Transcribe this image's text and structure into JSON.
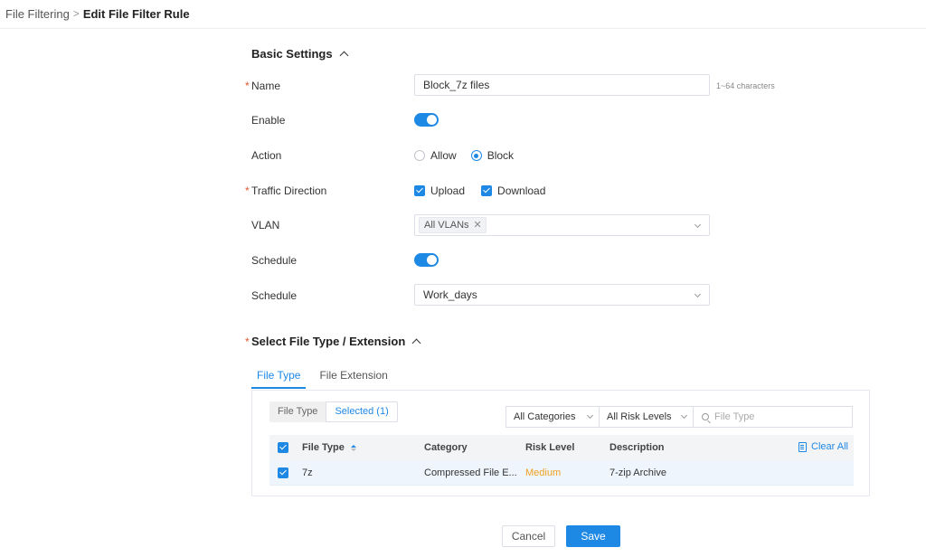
{
  "breadcrumb": {
    "parent": "File Filtering",
    "separator": ">",
    "current": "Edit File Filter Rule"
  },
  "basic_settings": {
    "title": "Basic Settings",
    "name": {
      "label": "Name",
      "value": "Block_7z files",
      "hint": "1~64 characters"
    },
    "enable": {
      "label": "Enable",
      "on": true
    },
    "action": {
      "label": "Action",
      "options": [
        "Allow",
        "Block"
      ],
      "selected": "Block"
    },
    "traffic_direction": {
      "label": "Traffic Direction",
      "upload": "Upload",
      "download": "Download",
      "upload_checked": true,
      "download_checked": true
    },
    "vlan": {
      "label": "VLAN",
      "tag": "All VLANs"
    },
    "schedule_toggle": {
      "label": "Schedule",
      "on": true
    },
    "schedule_select": {
      "label": "Schedule",
      "value": "Work_days"
    }
  },
  "file_section": {
    "title": "Select File Type / Extension",
    "tabs": [
      "File Type",
      "File Extension"
    ],
    "active_tab": "File Type",
    "segment": {
      "file_type": "File Type",
      "selected": "Selected (1)"
    },
    "filters": {
      "categories": "All Categories",
      "risk_levels": "All Risk Levels",
      "search_placeholder": "File Type"
    },
    "table": {
      "headers": {
        "file_type": "File Type",
        "category": "Category",
        "risk_level": "Risk Level",
        "description": "Description"
      },
      "clear_all": "Clear All",
      "rows": [
        {
          "file_type": "7z",
          "category": "Compressed File E...",
          "risk_level": "Medium",
          "description": "7-zip Archive",
          "checked": true
        }
      ]
    }
  },
  "footer": {
    "cancel": "Cancel",
    "save": "Save"
  },
  "colors": {
    "accent": "#1e88e5",
    "required": "#e4572e",
    "medium_risk": "#f0a020"
  }
}
